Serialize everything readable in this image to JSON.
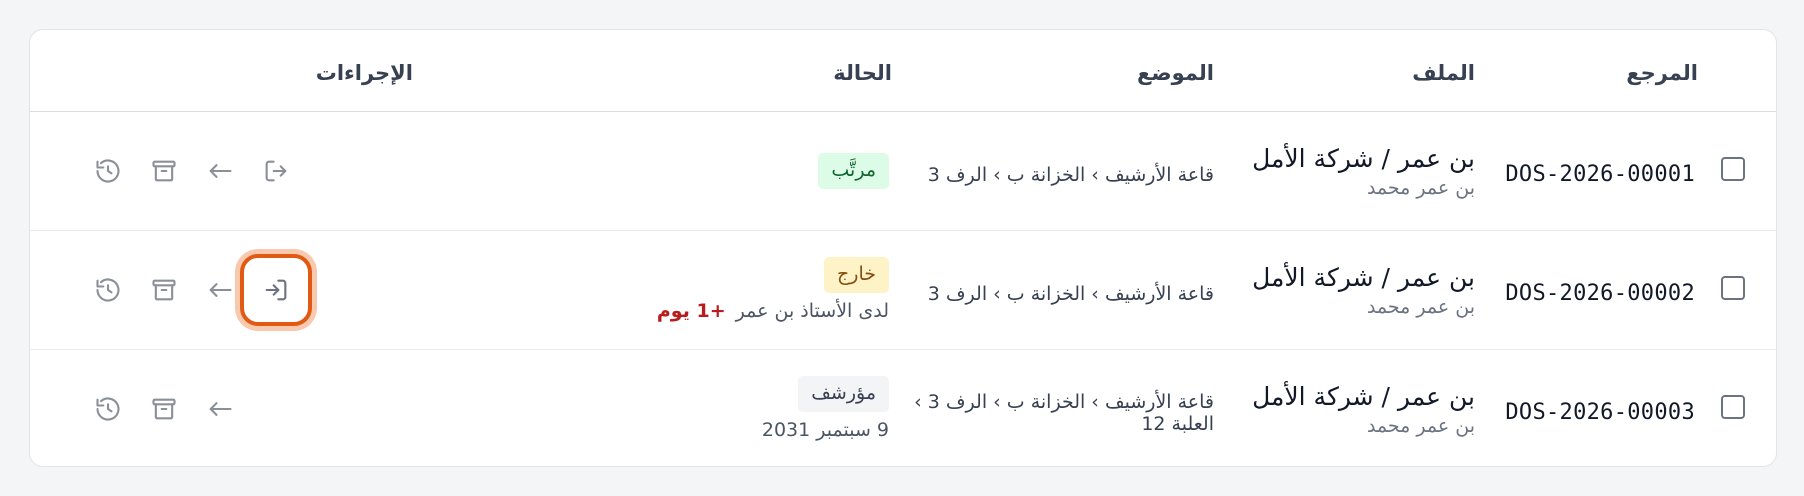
{
  "table": {
    "headers": {
      "reference": "المرجع",
      "file": "الملف",
      "location": "الموضع",
      "status": "الحالة",
      "actions": "الإجراءات"
    },
    "rows": [
      {
        "reference": "DOS-2026-00001",
        "file_title": "بن عمر / شركة الأمل",
        "file_sub": "بن عمر محمد",
        "location": "قاعة الأرشيف › الخزانة ب › الرف 3",
        "status_badge": "مرتَّب",
        "status_color": "#dcfce7",
        "status_sub": "",
        "overdue": "",
        "actions": [
          "checkout-icon",
          "arrow-left-icon",
          "archive-icon",
          "history-icon"
        ]
      },
      {
        "reference": "DOS-2026-00002",
        "file_title": "بن عمر / شركة الأمل",
        "file_sub": "بن عمر محمد",
        "location": "قاعة الأرشيف › الخزانة ب › الرف 3",
        "status_badge": "خارج",
        "status_color": "#fef3c7",
        "status_sub": "لدى الأستاذ بن عمر",
        "overdue": "+1 يوم",
        "actions": [
          "checkin-icon",
          "arrow-left-icon",
          "archive-icon",
          "history-icon"
        ]
      },
      {
        "reference": "DOS-2026-00003",
        "file_title": "بن عمر / شركة الأمل",
        "file_sub": "بن عمر محمد",
        "location": "قاعة الأرشيف › الخزانة ب › الرف 3 › العلبة 12",
        "status_badge": "مؤرشف",
        "status_color": "#f3f4f6",
        "status_sub": "9 سبتمبر 2031",
        "overdue": "",
        "actions": [
          "arrow-left-icon",
          "archive-icon",
          "history-icon"
        ]
      }
    ]
  },
  "colors": {
    "focus_ring": "#e05a16",
    "overdue": "#b91c1c",
    "icon": "#8a9098"
  }
}
